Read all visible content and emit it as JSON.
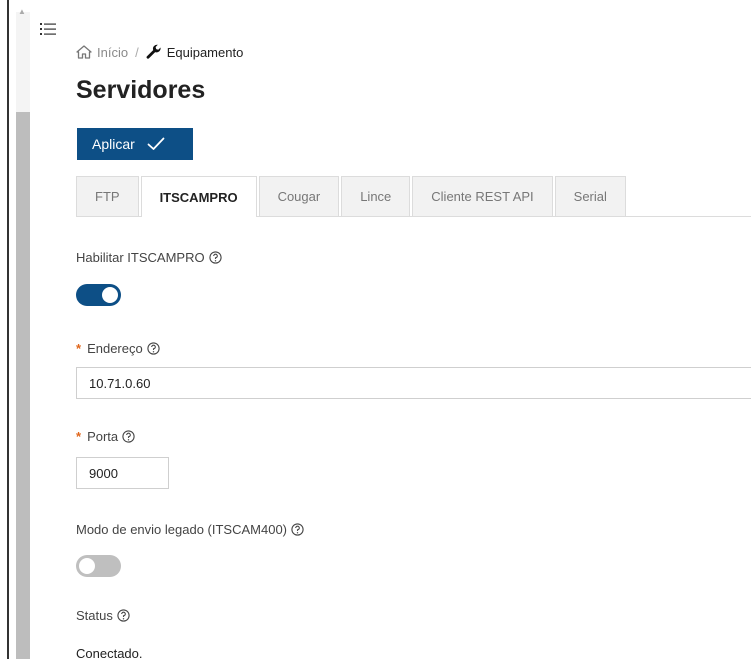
{
  "app": {
    "menu_icon": "list-icon"
  },
  "breadcrumb": {
    "home_icon": "home-icon",
    "home_label": "Início",
    "separator": "/",
    "current_icon": "wrench-icon",
    "current_label": "Equipamento"
  },
  "page": {
    "title": "Servidores"
  },
  "toolbar": {
    "apply_label": "Aplicar",
    "apply_icon": "check-icon"
  },
  "tabs": [
    {
      "label": "FTP",
      "active": false
    },
    {
      "label": "ITSCAMPRO",
      "active": true
    },
    {
      "label": "Cougar",
      "active": false
    },
    {
      "label": "Lince",
      "active": false
    },
    {
      "label": "Cliente REST API",
      "active": false
    },
    {
      "label": "Serial",
      "active": false
    }
  ],
  "form": {
    "enable": {
      "label": "Habilitar ITSCAMPRO",
      "value": true
    },
    "address": {
      "required_mark": "*",
      "label": "Endereço",
      "value": "10.71.0.60"
    },
    "port": {
      "required_mark": "*",
      "label": "Porta",
      "value": "9000"
    },
    "legacy_mode": {
      "label": "Modo de envio legado (ITSCAM400)",
      "value": false
    },
    "status": {
      "label": "Status",
      "value": "Conectado."
    }
  },
  "colors": {
    "primary": "#0d4f86",
    "required": "#e0661b",
    "toggle_off": "#bfbfbf"
  }
}
